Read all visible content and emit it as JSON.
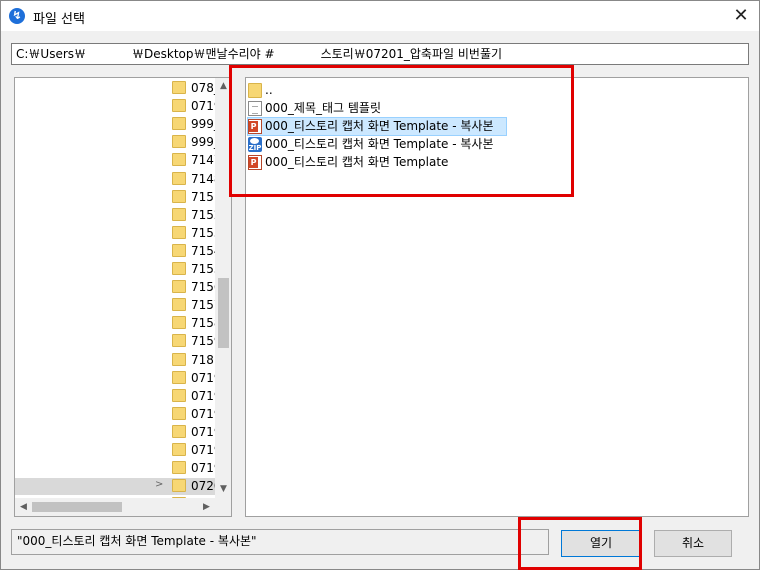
{
  "window": {
    "title": "파일 선택",
    "close_symbol": "✕",
    "app_icon": "⬡"
  },
  "path": {
    "part1": "C:￦Users￦",
    "part2": "￦Desktop￦맨날수리야 #",
    "part3": "스토리￦07201_압축파일 비번풀기"
  },
  "tree": {
    "items": [
      {
        "label": "078_"
      },
      {
        "label": "0719"
      },
      {
        "label": "999_"
      },
      {
        "label": "999_"
      },
      {
        "label": "7147"
      },
      {
        "label": "7148"
      },
      {
        "label": "7151"
      },
      {
        "label": "7152"
      },
      {
        "label": "7153"
      },
      {
        "label": "7154"
      },
      {
        "label": "7155"
      },
      {
        "label": "7156"
      },
      {
        "label": "7157"
      },
      {
        "label": "7158"
      },
      {
        "label": "7159"
      },
      {
        "label": "7181"
      },
      {
        "label": "0719"
      },
      {
        "label": "0719"
      },
      {
        "label": "0719"
      },
      {
        "label": "0719"
      },
      {
        "label": "0719"
      },
      {
        "label": "0719"
      },
      {
        "label": "0720"
      },
      {
        "label": "0720"
      }
    ],
    "expand_symbol": ">"
  },
  "files": {
    "items": [
      {
        "label": "..",
        "icon": "folder-icon"
      },
      {
        "label": "000_제목_태그 템플릿",
        "icon": "text-file-icon"
      },
      {
        "label": "000_티스토리 캡처 화면 Template - 복사본",
        "icon": "powerpoint-icon"
      },
      {
        "label": "000_티스토리 캡처 화면 Template - 복사본",
        "icon": "zip-icon"
      },
      {
        "label": "000_티스토리 캡처 화면 Template",
        "icon": "powerpoint-icon"
      }
    ]
  },
  "filename": {
    "value": "\"000_티스토리 캡처 화면 Template - 복사본\""
  },
  "buttons": {
    "open": "열기",
    "cancel": "취소"
  },
  "colors": {
    "highlight_border": "#e00000",
    "selection": "#cce8ff"
  }
}
